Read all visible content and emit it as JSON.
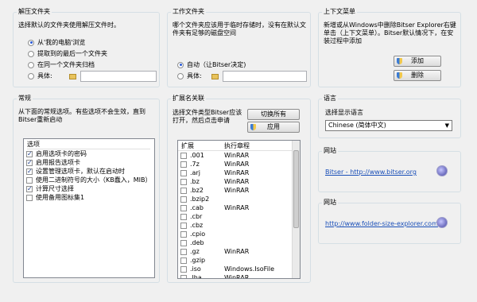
{
  "unzip": {
    "title": "解压文件夹",
    "desc": "选择默认的文件夹使用解压文件时。",
    "options": [
      "从'我的电脑'浏览",
      "提取到的最后一个文件夹",
      "在同一个文件夹归档",
      "具体:"
    ]
  },
  "workdir": {
    "title": "工作文件夹",
    "desc": "哪个文件夹应该用于临时存储时，没有在默认文件夹有足够的磁盘空间",
    "options": [
      "自动（让Bitser决定)",
      "具体:"
    ]
  },
  "context": {
    "title": "上下文菜单",
    "desc": "新增或从Windows中删除Bitser Explorer右键单击（上下文菜单）。Bitser默认情况下，在安装过程中添加",
    "add_label": "添加",
    "remove_label": "删除"
  },
  "general": {
    "title": "常规",
    "desc": "从下面的常规选项。有些选项不会生效，直到Bitser重新启动",
    "header": "选项",
    "items": [
      {
        "label": "启用选项卡的密码",
        "checked": true
      },
      {
        "label": "启用报告选项卡",
        "checked": true
      },
      {
        "label": "设置管理选项卡，默认在启动时",
        "checked": true
      },
      {
        "label": "使用二进制符号的大小（KB蠢入，MIB）",
        "checked": false
      },
      {
        "label": "计算尺寸选择",
        "checked": true
      },
      {
        "label": "使用备用图标集1",
        "checked": false
      }
    ]
  },
  "assoc": {
    "title": "扩展名关联",
    "desc": "选择文件类型Bitser应该打开，然后点击申请",
    "toggle_label": "切换所有",
    "apply_label": "应用",
    "col_ext": "扩展",
    "col_prog": "执行章程",
    "rows": [
      {
        "ext": ".001",
        "prog": "WinRAR"
      },
      {
        "ext": ".7z",
        "prog": "WinRAR"
      },
      {
        "ext": ".arj",
        "prog": "WinRAR"
      },
      {
        "ext": ".bz",
        "prog": "WinRAR"
      },
      {
        "ext": ".bz2",
        "prog": "WinRAR"
      },
      {
        "ext": ".bzip2",
        "prog": ""
      },
      {
        "ext": ".cab",
        "prog": "WinRAR"
      },
      {
        "ext": ".cbr",
        "prog": ""
      },
      {
        "ext": ".cbz",
        "prog": ""
      },
      {
        "ext": ".cpio",
        "prog": ""
      },
      {
        "ext": ".deb",
        "prog": ""
      },
      {
        "ext": ".gz",
        "prog": "WinRAR"
      },
      {
        "ext": ".gzip",
        "prog": ""
      },
      {
        "ext": ".iso",
        "prog": "Windows.IsoFile"
      },
      {
        "ext": ".lha",
        "prog": "WinRAR"
      }
    ]
  },
  "language": {
    "title": "语言",
    "desc": "选择显示语言",
    "selected": "Chinese (简体中文)"
  },
  "site1": {
    "title": "网站",
    "link": "Bitser - http://www.bitser.org"
  },
  "site2": {
    "title": "网站",
    "link": "http://www.folder-size-explorer.com"
  }
}
